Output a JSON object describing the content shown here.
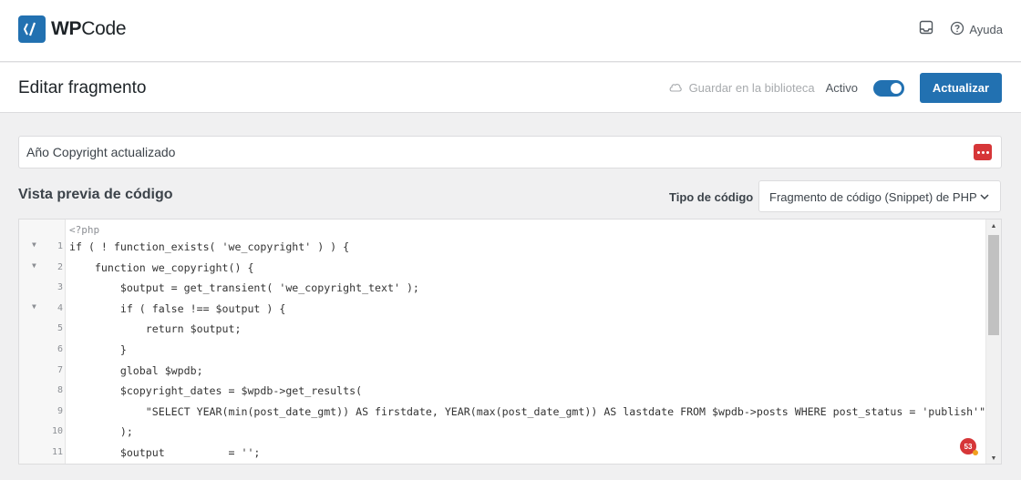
{
  "brand": {
    "name_prefix": "WP",
    "name_suffix": "Code"
  },
  "header": {
    "help_label": "Ayuda"
  },
  "titlebar": {
    "title": "Editar fragmento",
    "save_library_label": "Guardar en la biblioteca",
    "active_label": "Activo",
    "active": true,
    "update_label": "Actualizar"
  },
  "snippet": {
    "title_value": "Año Copyright actualizado"
  },
  "preview": {
    "section_title": "Vista previa de código",
    "code_type_label": "Tipo de código",
    "code_type_value": "Fragmento de código (Snippet) de PHP"
  },
  "editor": {
    "php_open_tag": "<?php",
    "lines": [
      {
        "num": "1",
        "fold": true,
        "code": "if ( ! function_exists( 'we_copyright' ) ) {"
      },
      {
        "num": "2",
        "fold": true,
        "code": "    function we_copyright() {"
      },
      {
        "num": "3",
        "fold": false,
        "code": "        $output = get_transient( 'we_copyright_text' );"
      },
      {
        "num": "4",
        "fold": true,
        "code": "        if ( false !== $output ) {"
      },
      {
        "num": "5",
        "fold": false,
        "code": "            return $output;"
      },
      {
        "num": "6",
        "fold": false,
        "code": "        }"
      },
      {
        "num": "7",
        "fold": false,
        "code": "        global $wpdb;"
      },
      {
        "num": "8",
        "fold": false,
        "code": "        $copyright_dates = $wpdb->get_results("
      },
      {
        "num": "9",
        "fold": false,
        "code": "            \"SELECT YEAR(min(post_date_gmt)) AS firstdate, YEAR(max(post_date_gmt)) AS lastdate FROM $wpdb->posts WHERE post_status = 'publish'\""
      },
      {
        "num": "10",
        "fold": false,
        "code": "        );"
      },
      {
        "num": "11",
        "fold": false,
        "code": "        $output          = '';"
      }
    ],
    "issue_count": "53"
  },
  "colors": {
    "accent": "#2271b1",
    "danger": "#d63638"
  }
}
